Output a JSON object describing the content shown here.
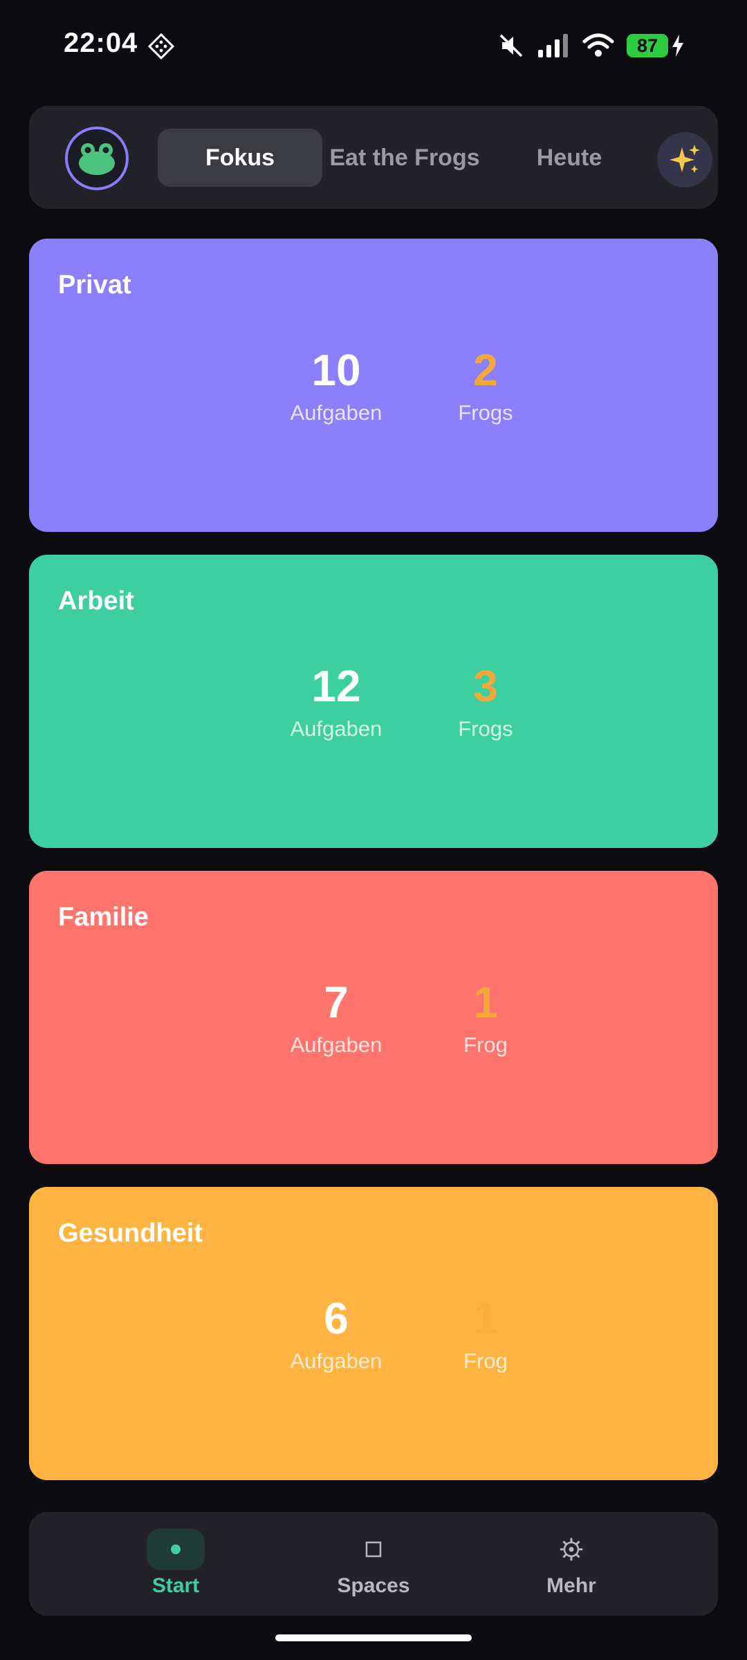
{
  "status_bar": {
    "time": "22:04",
    "battery": "87",
    "icons": [
      "app-notification-icon",
      "mute-icon",
      "signal-icon",
      "wifi-icon",
      "battery-icon",
      "charging-icon"
    ]
  },
  "top_nav": {
    "avatar_icon": "frog-icon",
    "tabs": [
      {
        "label": "Fokus",
        "active": true
      },
      {
        "label": "Eat the Frogs",
        "active": false
      },
      {
        "label": "Heute",
        "active": false
      }
    ],
    "sparkle_icon": "sparkles-icon"
  },
  "cards": [
    {
      "title": "Privat",
      "tasks": "10",
      "tasks_label": "Aufgaben",
      "frogs": "2",
      "frogs_label": "Frogs",
      "color": "#8b7ffc"
    },
    {
      "title": "Arbeit",
      "tasks": "12",
      "tasks_label": "Aufgaben",
      "frogs": "3",
      "frogs_label": "Frogs",
      "color": "#3ecfa1"
    },
    {
      "title": "Familie",
      "tasks": "7",
      "tasks_label": "Aufgaben",
      "frogs": "1",
      "frogs_label": "Frog",
      "color": "#ff756d"
    },
    {
      "title": "Gesundheit",
      "tasks": "6",
      "tasks_label": "Aufgaben",
      "frogs": "1",
      "frogs_label": "Frog",
      "color": "#ffb340"
    }
  ],
  "bottom_nav": {
    "items": [
      {
        "label": "Start",
        "icon": "dot-icon",
        "active": true
      },
      {
        "label": "Spaces",
        "icon": "square-icon",
        "active": false
      },
      {
        "label": "Mehr",
        "icon": "gear-icon",
        "active": false
      }
    ]
  },
  "colors": {
    "background": "#0b0b10",
    "panel": "#222228",
    "accent_green": "#3ecfa1",
    "frog_orange": "#f5a83a",
    "avatar_ring": "#8a7dfc"
  }
}
